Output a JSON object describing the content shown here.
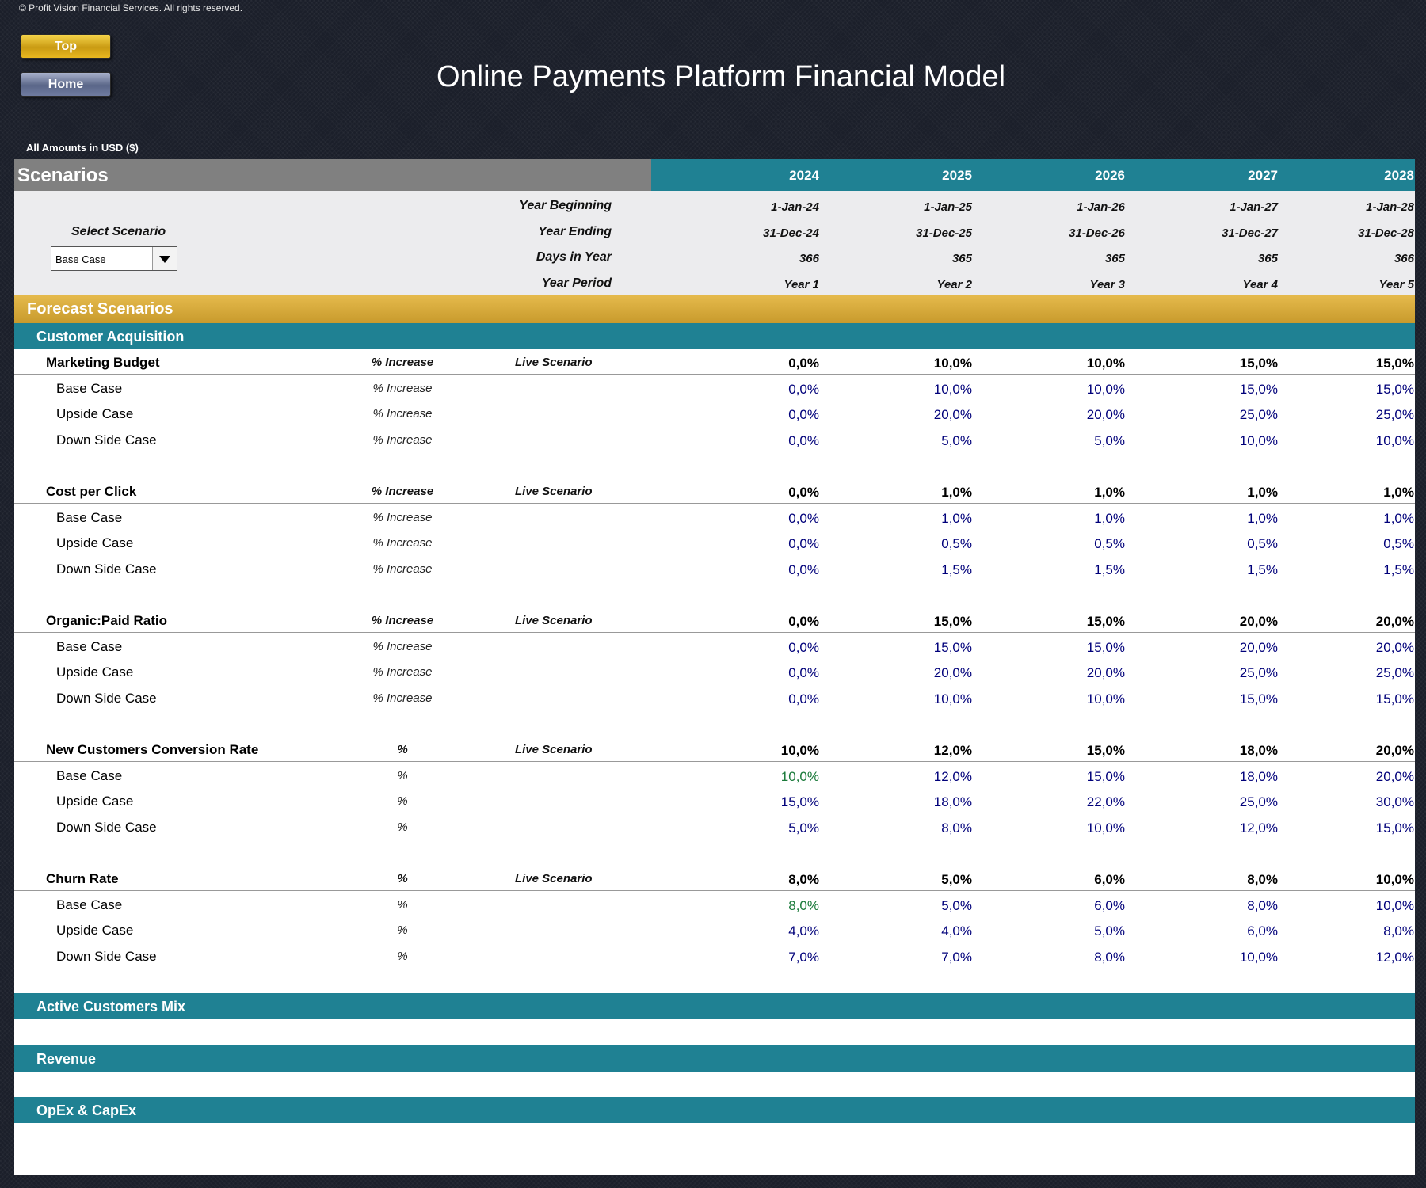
{
  "copyright": "© Profit Vision Financial Services. All rights reserved.",
  "nav": {
    "top_label": "Top",
    "home_label": "Home"
  },
  "title": "Online Payments Platform Financial Model",
  "amounts_note": "All Amounts in  USD ($)",
  "scenarios_header": {
    "title": "Scenarios",
    "years": [
      "2024",
      "2025",
      "2026",
      "2027",
      "2028"
    ]
  },
  "year_info": {
    "labels": {
      "begin": "Year Beginning",
      "end": "Year Ending",
      "days": "Days in Year",
      "period": "Year Period"
    },
    "year_beginning": [
      "1-Jan-24",
      "1-Jan-25",
      "1-Jan-26",
      "1-Jan-27",
      "1-Jan-28"
    ],
    "year_ending": [
      "31-Dec-24",
      "31-Dec-25",
      "31-Dec-26",
      "31-Dec-27",
      "31-Dec-28"
    ],
    "days_in_year": [
      "366",
      "365",
      "365",
      "365",
      "366"
    ],
    "year_period": [
      "Year 1",
      "Year 2",
      "Year 3",
      "Year 4",
      "Year 5"
    ]
  },
  "select_scenario": {
    "label": "Select Scenario",
    "value": "Base Case"
  },
  "forecast_title": "Forecast Scenarios",
  "sections": {
    "customer_acquisition": "Customer Acquisition",
    "active_customers_mix": "Active Customers Mix",
    "revenue": "Revenue",
    "opex_capex": "OpEx & CapEx"
  },
  "live_label": "Live Scenario",
  "colors": {
    "teal": "#1f8193",
    "gold": "#d9ad3c",
    "navy_value": "#00007a",
    "green_value": "#1a7a3a"
  },
  "metrics": [
    {
      "name": "Marketing Budget",
      "unit": "% Increase",
      "live": [
        "0,0%",
        "10,0%",
        "10,0%",
        "15,0%",
        "15,0%"
      ],
      "cases": [
        {
          "name": "Base Case",
          "unit": "% Increase",
          "values": [
            "0,0%",
            "10,0%",
            "10,0%",
            "15,0%",
            "15,0%"
          ]
        },
        {
          "name": "Upside Case",
          "unit": "% Increase",
          "values": [
            "0,0%",
            "20,0%",
            "20,0%",
            "25,0%",
            "25,0%"
          ]
        },
        {
          "name": "Down Side Case",
          "unit": "% Increase",
          "values": [
            "0,0%",
            "5,0%",
            "5,0%",
            "10,0%",
            "10,0%"
          ]
        }
      ]
    },
    {
      "name": "Cost per Click",
      "unit": "% Increase",
      "live": [
        "0,0%",
        "1,0%",
        "1,0%",
        "1,0%",
        "1,0%"
      ],
      "cases": [
        {
          "name": "Base Case",
          "unit": "% Increase",
          "values": [
            "0,0%",
            "1,0%",
            "1,0%",
            "1,0%",
            "1,0%"
          ]
        },
        {
          "name": "Upside Case",
          "unit": "% Increase",
          "values": [
            "0,0%",
            "0,5%",
            "0,5%",
            "0,5%",
            "0,5%"
          ]
        },
        {
          "name": "Down Side Case",
          "unit": "% Increase",
          "values": [
            "0,0%",
            "1,5%",
            "1,5%",
            "1,5%",
            "1,5%"
          ]
        }
      ]
    },
    {
      "name": "Organic:Paid Ratio",
      "unit": "% Increase",
      "live": [
        "0,0%",
        "15,0%",
        "15,0%",
        "20,0%",
        "20,0%"
      ],
      "cases": [
        {
          "name": "Base Case",
          "unit": "% Increase",
          "values": [
            "0,0%",
            "15,0%",
            "15,0%",
            "20,0%",
            "20,0%"
          ]
        },
        {
          "name": "Upside Case",
          "unit": "% Increase",
          "values": [
            "0,0%",
            "20,0%",
            "20,0%",
            "25,0%",
            "25,0%"
          ]
        },
        {
          "name": "Down Side Case",
          "unit": "% Increase",
          "values": [
            "0,0%",
            "10,0%",
            "10,0%",
            "15,0%",
            "15,0%"
          ]
        }
      ]
    },
    {
      "name": "New Customers Conversion Rate",
      "unit": "%",
      "live": [
        "10,0%",
        "12,0%",
        "15,0%",
        "18,0%",
        "20,0%"
      ],
      "cases": [
        {
          "name": "Base Case",
          "unit": "%",
          "values": [
            "10,0%",
            "12,0%",
            "15,0%",
            "18,0%",
            "20,0%"
          ],
          "first_green": true
        },
        {
          "name": "Upside Case",
          "unit": "%",
          "values": [
            "15,0%",
            "18,0%",
            "22,0%",
            "25,0%",
            "30,0%"
          ]
        },
        {
          "name": "Down Side Case",
          "unit": "%",
          "values": [
            "5,0%",
            "8,0%",
            "10,0%",
            "12,0%",
            "15,0%"
          ]
        }
      ]
    },
    {
      "name": "Churn Rate",
      "unit": "%",
      "live": [
        "8,0%",
        "5,0%",
        "6,0%",
        "8,0%",
        "10,0%"
      ],
      "cases": [
        {
          "name": "Base Case",
          "unit": "%",
          "values": [
            "8,0%",
            "5,0%",
            "6,0%",
            "8,0%",
            "10,0%"
          ],
          "first_green": true
        },
        {
          "name": "Upside Case",
          "unit": "%",
          "values": [
            "4,0%",
            "4,0%",
            "5,0%",
            "6,0%",
            "8,0%"
          ]
        },
        {
          "name": "Down Side Case",
          "unit": "%",
          "values": [
            "7,0%",
            "7,0%",
            "8,0%",
            "10,0%",
            "12,0%"
          ]
        }
      ]
    }
  ]
}
